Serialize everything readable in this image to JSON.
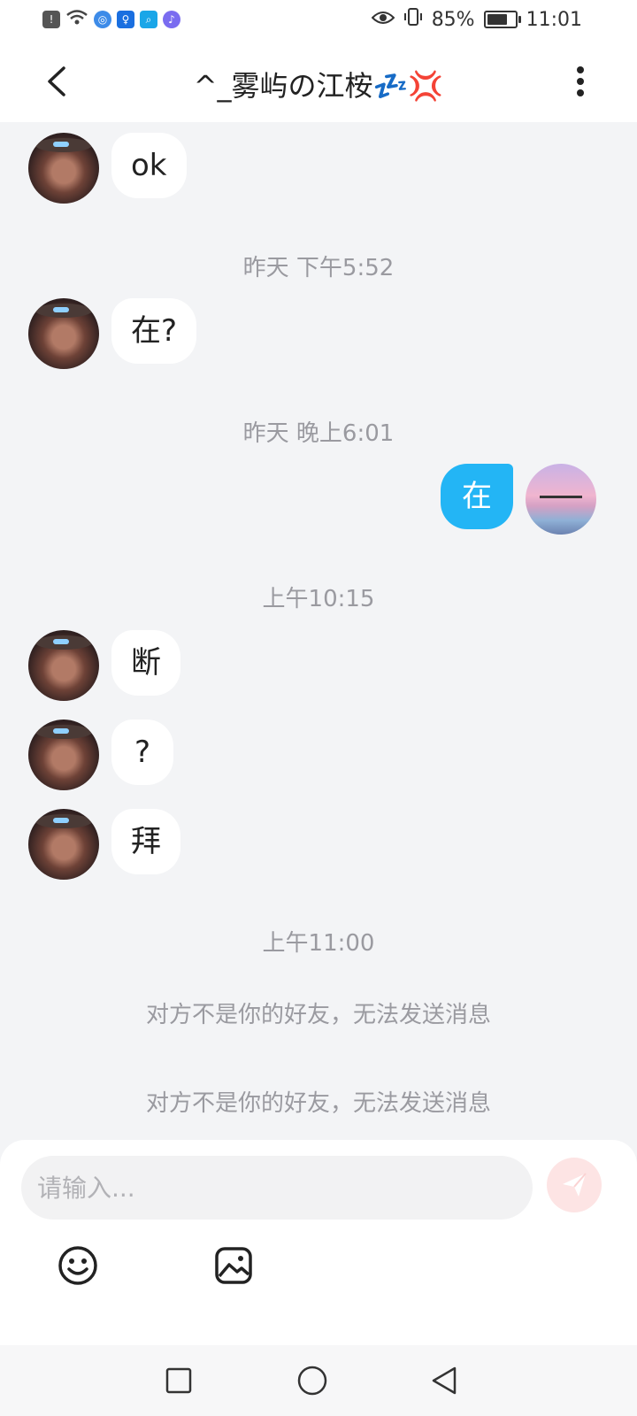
{
  "status_bar": {
    "battery": "85%",
    "battery_level": 0.85,
    "time": "11:01",
    "icons": [
      "alert-icon",
      "wifi-icon",
      "globe-icon",
      "lightbulb-icon",
      "search-app-icon",
      "music-icon",
      "eye-icon",
      "vibrate-icon"
    ]
  },
  "header": {
    "title": "^_雾屿の江桉💤💢",
    "back_icon": "chevron-left-icon",
    "menu_icon": "more-vertical-icon"
  },
  "messages": [
    {
      "type": "in",
      "text": "ok"
    },
    {
      "type": "time",
      "text": "昨天 下午5:52"
    },
    {
      "type": "in",
      "text": "在?"
    },
    {
      "type": "time",
      "text": "昨天 晚上6:01"
    },
    {
      "type": "out",
      "text": "在"
    },
    {
      "type": "time",
      "text": "上午10:15"
    },
    {
      "type": "in",
      "text": "断"
    },
    {
      "type": "in",
      "text": "?"
    },
    {
      "type": "in",
      "text": "拜"
    },
    {
      "type": "time",
      "text": "上午11:00"
    },
    {
      "type": "notice",
      "text": "对方不是你的好友，无法发送消息"
    },
    {
      "type": "notice",
      "text": "对方不是你的好友，无法发送消息"
    }
  ],
  "composer": {
    "placeholder": "请输入...",
    "value": "",
    "send_icon": "send-icon",
    "tools": [
      "emoji-icon",
      "image-icon"
    ]
  },
  "nav": {
    "buttons": [
      "recents-icon",
      "home-icon",
      "back-icon"
    ]
  },
  "colors": {
    "accent": "#23b5f5",
    "send_disabled": "#fde4e4",
    "timestamp": "#9a9aa0"
  }
}
